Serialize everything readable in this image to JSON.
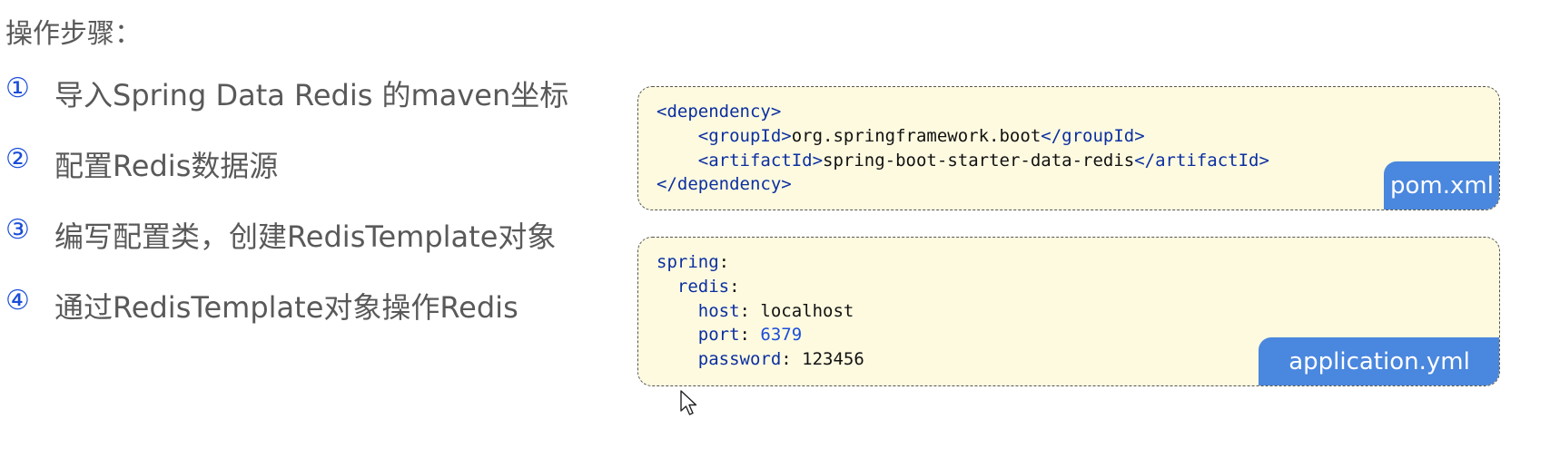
{
  "heading": "操作步骤：",
  "steps": [
    {
      "num": "①",
      "text": "导入Spring Data Redis 的maven坐标"
    },
    {
      "num": "②",
      "text": "配置Redis数据源"
    },
    {
      "num": "③",
      "text": "编写配置类，创建RedisTemplate对象"
    },
    {
      "num": "④",
      "text": "通过RedisTemplate对象操作Redis"
    }
  ],
  "pom_card": {
    "label": "pom.xml",
    "lines": [
      {
        "open": "<dependency>"
      },
      {
        "indent": "    ",
        "tag_open": "<groupId>",
        "value": "org.springframework.boot",
        "tag_close": "</groupId>"
      },
      {
        "indent": "    ",
        "tag_open": "<artifactId>",
        "value": "spring-boot-starter-data-redis",
        "tag_close": "</artifactId>"
      },
      {
        "close": "</dependency>"
      }
    ]
  },
  "yml_card": {
    "label": "application.yml",
    "lines": [
      {
        "key": "spring",
        "sep": ":",
        "value": ""
      },
      {
        "key": "redis",
        "sep": ":",
        "value": ""
      },
      {
        "key": "host",
        "sep": ": ",
        "value": "localhost"
      },
      {
        "key": "port",
        "sep": ": ",
        "value": "6379"
      },
      {
        "key": "password",
        "sep": ": ",
        "value": "123456"
      }
    ]
  },
  "colors": {
    "tag_color": "#0b2fa0",
    "card_bg": "#fefae0",
    "label_bg": "#4a87de",
    "text_gray": "#595959"
  },
  "icons": {
    "cursor": "mouse-pointer-icon"
  }
}
